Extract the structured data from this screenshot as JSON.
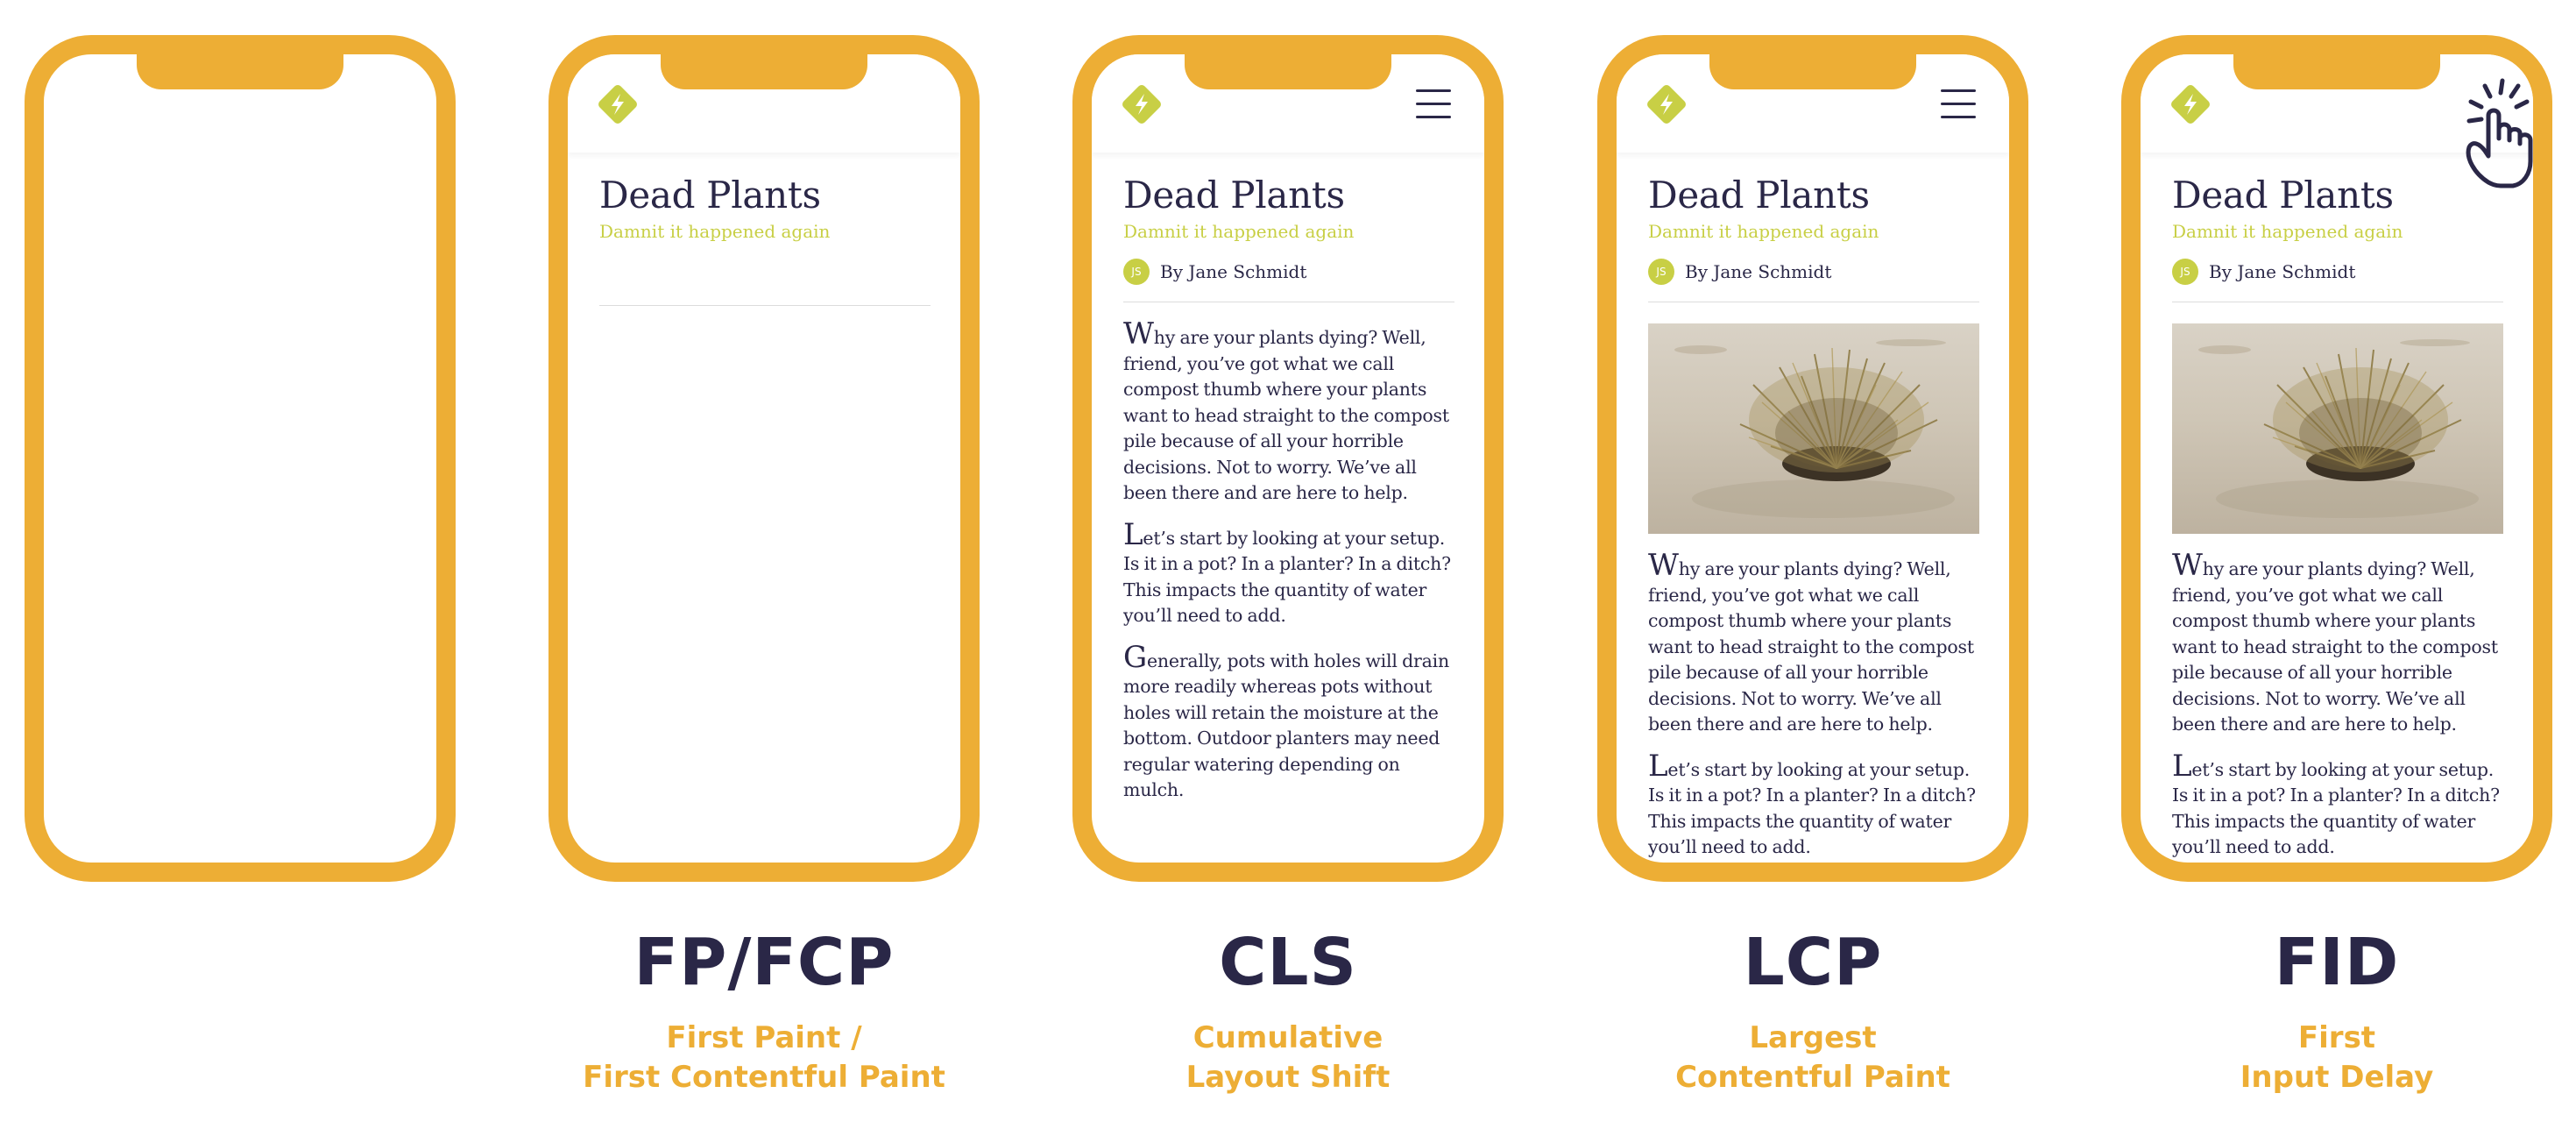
{
  "article": {
    "title": "Dead Plants",
    "subtitle": "Damnit it happened again",
    "author_initials": "JS",
    "author": "By Jane Schmidt",
    "p1_cap": "W",
    "p1_rest": "hy are your plants dying? Well, friend, you’ve got what we call compost thumb where your plants want to head straight to the compost pile because of all your horrible decisions. Not to worry. We’ve all been there and are here to help.",
    "p2_cap": "L",
    "p2_rest": "et’s start by looking at your setup. Is it in a pot? In a planter? In a ditch? This impacts the quantity of water you’ll need to add.",
    "p3_cap": "G",
    "p3_rest": "enerally, pots with holes will drain more readily whereas pots without holes will retain the mois­ture at the bottom. Outdoor planters may need regular watering depend­ing on mulch."
  },
  "stages": [
    {
      "abbr": "",
      "line1": "",
      "line2": ""
    },
    {
      "abbr": "FP/FCP",
      "line1": "First Paint /",
      "line2": "First Contentful Paint"
    },
    {
      "abbr": "CLS",
      "line1": "Cumulative",
      "line2": "Layout Shift"
    },
    {
      "abbr": "LCP",
      "line1": "Largest",
      "line2": "Contentful Paint"
    },
    {
      "abbr": "FID",
      "line1": "First",
      "line2": "Input Delay"
    }
  ],
  "colors": {
    "frame": "#EDAE35",
    "heading": "#2a2747",
    "accent": "#c8cf45",
    "label": "#EDAE35"
  },
  "icons": {
    "logo": "lightning-diamond-icon",
    "menu": "hamburger-menu-icon",
    "tap": "tapping-hand-icon"
  }
}
